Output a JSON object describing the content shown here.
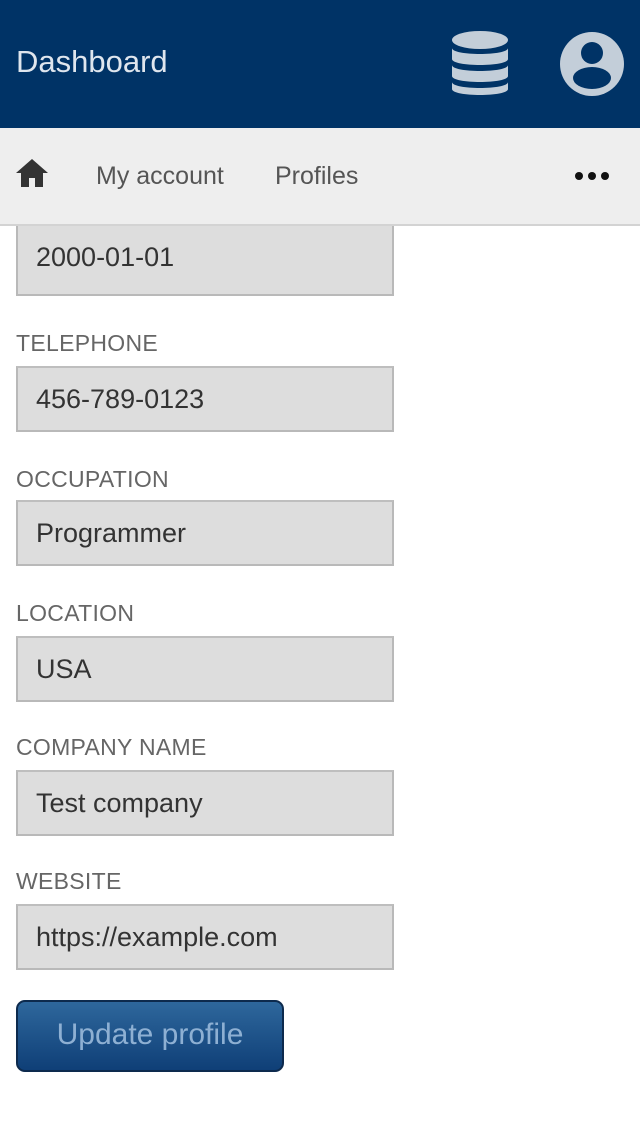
{
  "header": {
    "title": "Dashboard",
    "database_icon": "database-icon",
    "account_icon": "user-circle-icon"
  },
  "nav": {
    "home_icon": "home-icon",
    "items": [
      {
        "label": "My account"
      },
      {
        "label": "Profiles"
      }
    ],
    "more_icon": "ellipsis-icon"
  },
  "form": {
    "birthdate": {
      "value": "2000-01-01"
    },
    "telephone": {
      "label": "TELEPHONE",
      "value": "456-789-0123"
    },
    "occupation": {
      "label": "OCCUPATION",
      "value": "Programmer"
    },
    "location": {
      "label": "LOCATION",
      "value": "USA"
    },
    "company_name": {
      "label": "COMPANY NAME",
      "value": "Test company"
    },
    "website": {
      "label": "WEBSITE",
      "value": "https://example.com"
    },
    "submit_label": "Update profile"
  },
  "colors": {
    "header_bg": "#003366",
    "nav_bg": "#eeeeee",
    "input_bg": "#dddddd",
    "button_bg": "#1a4f86"
  }
}
